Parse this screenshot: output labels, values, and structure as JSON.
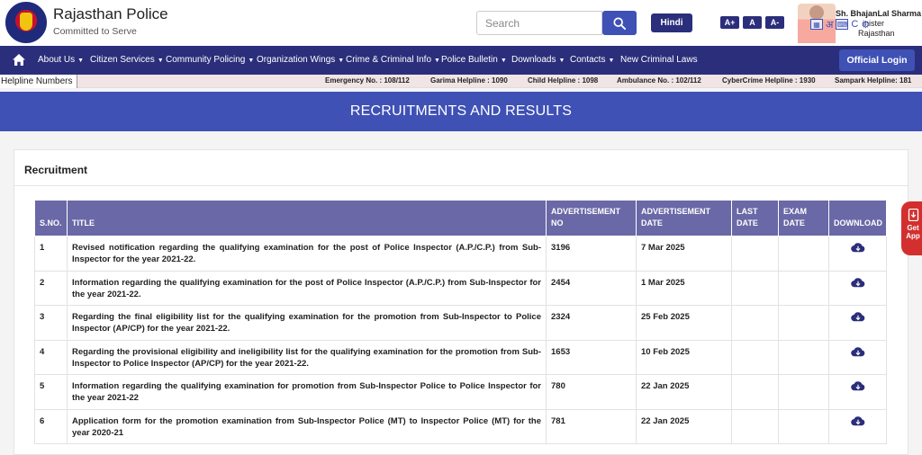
{
  "header": {
    "title": "Rajasthan Police",
    "tagline": "Committed to Serve",
    "search": {
      "placeholder": "Search",
      "icon": "search-icon"
    },
    "language_button": "Hindi",
    "font_controls": [
      "A+",
      "A",
      "A-"
    ],
    "cm": {
      "name": "Sh. BhajanLal Sharma",
      "role": "inister",
      "state": "Rajasthan"
    },
    "accessibility_glyphs": [
      "अ",
      "C"
    ]
  },
  "nav": {
    "items": [
      {
        "label": "About Us",
        "caret": true
      },
      {
        "label": "Citizen Services",
        "caret": true
      },
      {
        "label": "Community Policing",
        "caret": true
      },
      {
        "label": "Organization Wings",
        "caret": true
      },
      {
        "label": "Crime & Criminal Info",
        "caret": true
      },
      {
        "label": "Police Bulletin",
        "caret": true
      },
      {
        "label": "Downloads",
        "caret": true
      },
      {
        "label": "Contacts",
        "caret": true
      },
      {
        "label": "New Criminal Laws",
        "caret": false
      }
    ],
    "login_label": "Official Login"
  },
  "helpline": {
    "label": "Helpline Numbers",
    "items": [
      "Emergency No. : 108/112",
      "Garima Helpline : 1090",
      "Child Helpline : 1098",
      "Ambulance No. : 102/112",
      "CyberCrime Helpline : 1930",
      "Sampark Helpline: 181"
    ]
  },
  "banner": {
    "title": "RECRUITMENTS AND RESULTS"
  },
  "section": {
    "title": "Recruitment",
    "columns": [
      "S.NO.",
      "TITLE",
      "ADVERTISEMENT NO",
      "ADVERTISEMENT DATE",
      "LAST DATE",
      "EXAM DATE",
      "DOWNLOAD"
    ],
    "rows": [
      {
        "sno": "1",
        "title": "Revised notification regarding the qualifying examination for the post of Police Inspector (A.P./C.P.) from Sub-Inspector for the year 2021-22.",
        "adv_no": "3196",
        "adv_date": "7 Mar 2025",
        "last_date": "",
        "exam_date": ""
      },
      {
        "sno": "2",
        "title": "Information regarding the qualifying examination for the post of Police Inspector (A.P./C.P.) from Sub-Inspector for the year 2021-22.",
        "adv_no": "2454",
        "adv_date": "1 Mar 2025",
        "last_date": "",
        "exam_date": ""
      },
      {
        "sno": "3",
        "title": "Regarding the final eligibility list for the qualifying examination for the promotion from Sub-Inspector to Police Inspector (AP/CP) for the year 2021-22.",
        "adv_no": "2324",
        "adv_date": "25 Feb 2025",
        "last_date": "",
        "exam_date": ""
      },
      {
        "sno": "4",
        "title": "Regarding the provisional eligibility and ineligibility list for the qualifying examination for the promotion from Sub-Inspector to Police Inspector (AP/CP) for the year 2021-22.",
        "adv_no": "1653",
        "adv_date": "10 Feb 2025",
        "last_date": "",
        "exam_date": ""
      },
      {
        "sno": "5",
        "title": "Information regarding the qualifying examination for promotion from Sub-Inspector Police to Police Inspector for the year 2021-22",
        "adv_no": "780",
        "adv_date": "22 Jan 2025",
        "last_date": "",
        "exam_date": ""
      },
      {
        "sno": "6",
        "title": "Application form for the promotion examination from Sub-Inspector Police (MT) to Inspector Police (MT) for the year 2020-21",
        "adv_no": "781",
        "adv_date": "22 Jan 2025",
        "last_date": "",
        "exam_date": ""
      }
    ]
  },
  "get_app": {
    "label_line1": "Get",
    "label_line2": "App"
  },
  "colors": {
    "nav_bg": "#2b2e7a",
    "accent": "#3f51b5",
    "table_header": "#6a68a7",
    "get_app": "#d32f2f"
  }
}
